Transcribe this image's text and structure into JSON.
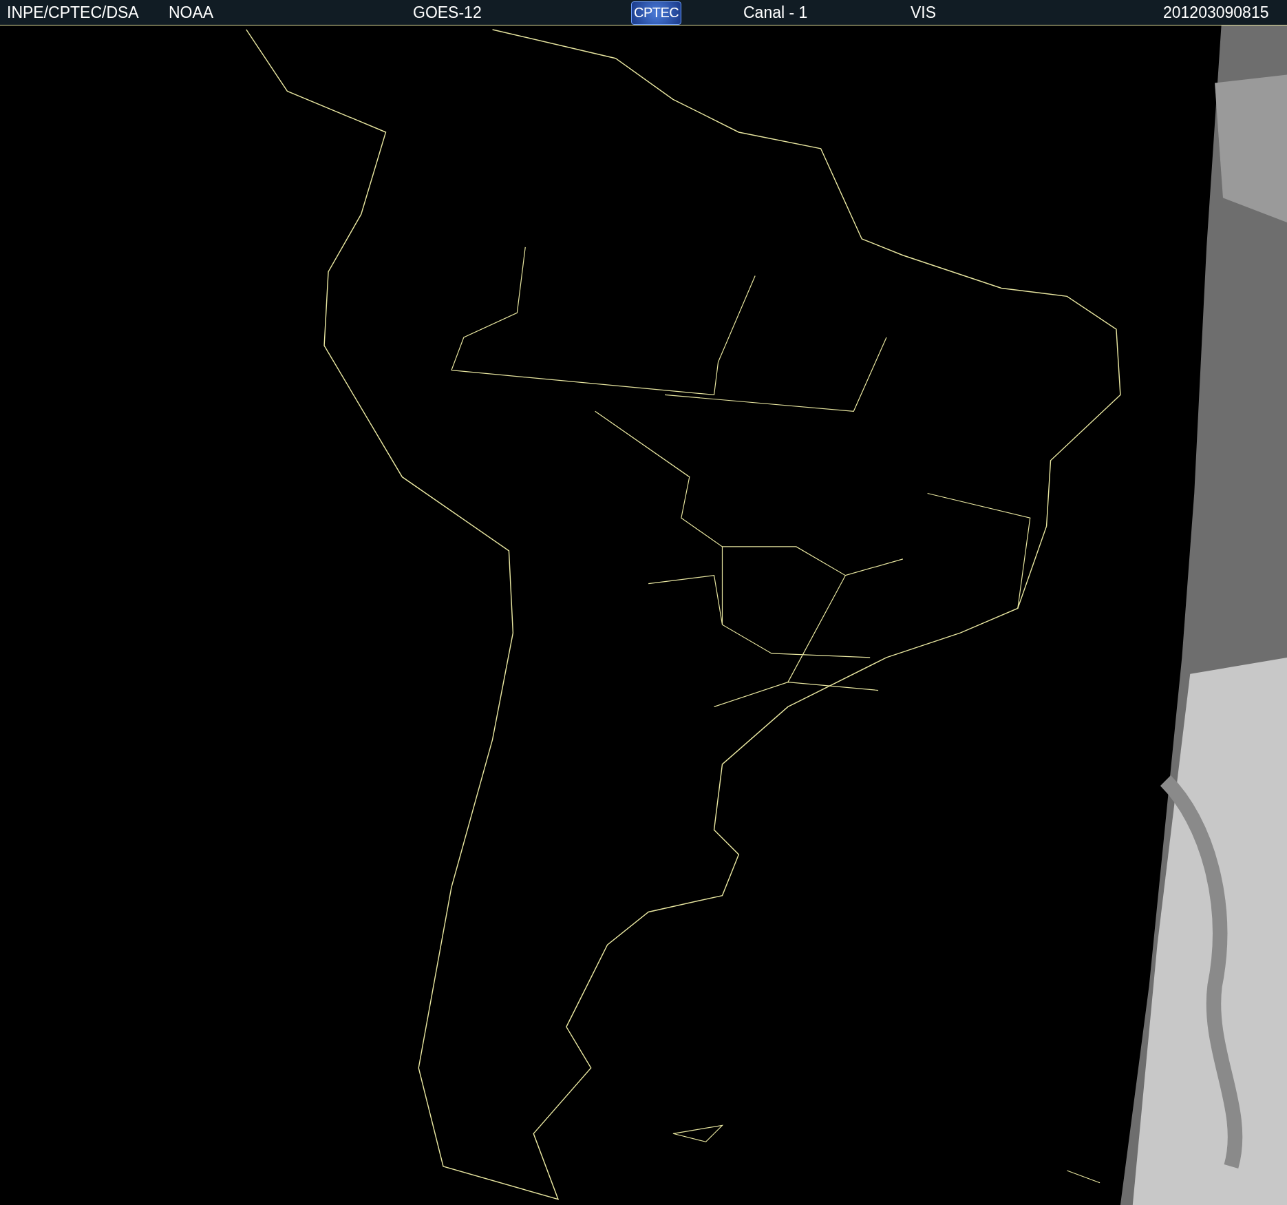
{
  "header": {
    "source": "INPE/CPTEC/DSA",
    "agency": "NOAA",
    "satellite": "GOES-12",
    "logo": "CPTEC",
    "channel": "Canal - 1",
    "band": "VIS",
    "timestamp": "201203090815"
  }
}
